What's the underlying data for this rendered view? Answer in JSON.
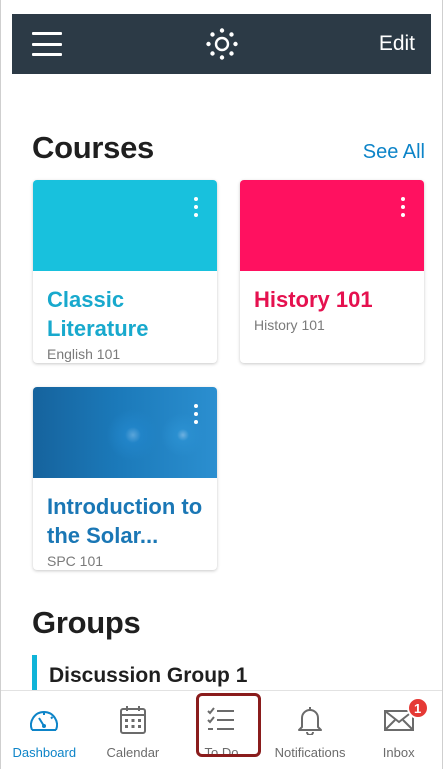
{
  "navbar": {
    "menu_icon": "hamburger-icon",
    "logo_icon": "canvas-logo",
    "edit_label": "Edit",
    "background": "#2c3a46"
  },
  "courses": {
    "title": "Courses",
    "see_all_label": "See All",
    "items": [
      {
        "title": "Classic Literature",
        "code": "English 101",
        "color": "#18c1dd"
      },
      {
        "title": "History 101",
        "code": "History 101",
        "color": "#ff1160"
      },
      {
        "title": "Introduction to the Solar...",
        "code": "SPC 101",
        "color": "#1b79b9"
      }
    ]
  },
  "groups": {
    "title": "Groups",
    "items": [
      {
        "name": "Discussion Group 1"
      }
    ]
  },
  "tabbar": {
    "tabs": [
      {
        "label": "Dashboard",
        "icon": "dashboard-icon",
        "active": true
      },
      {
        "label": "Calendar",
        "icon": "calendar-icon",
        "active": false
      },
      {
        "label": "To Do",
        "icon": "todo-list-icon",
        "active": false,
        "highlighted": true
      },
      {
        "label": "Notifications",
        "icon": "bell-icon",
        "active": false
      },
      {
        "label": "Inbox",
        "icon": "envelope-icon",
        "active": false,
        "badge": "1"
      }
    ],
    "active_color": "#0d84c8",
    "badge_color": "#e53935"
  }
}
